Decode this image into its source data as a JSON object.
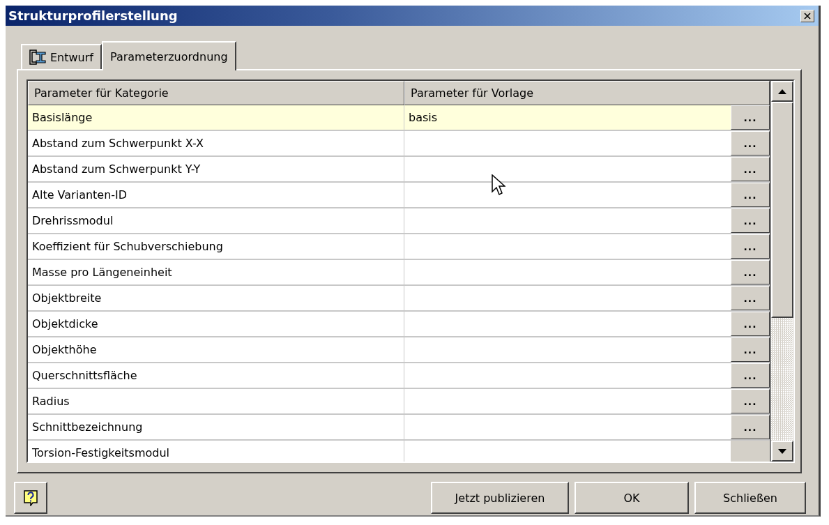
{
  "window": {
    "title": "Strukturprofilerstellung"
  },
  "tabs": [
    {
      "label": "Entwurf",
      "selected": false,
      "icon": true
    },
    {
      "label": "Parameterzuordnung",
      "selected": true,
      "icon": false
    }
  ],
  "table": {
    "columns": [
      "Parameter für Kategorie",
      "Parameter für Vorlage"
    ],
    "rows": [
      {
        "category": "Basislänge",
        "template": "basis",
        "button": "...",
        "selected": true
      },
      {
        "category": "Abstand zum Schwerpunkt X-X",
        "button": "...",
        "selected": false
      },
      {
        "category": "Abstand zum Schwerpunkt Y-Y",
        "button": "...",
        "selected": false
      },
      {
        "category": "Alte Varianten-ID",
        "button": "...",
        "selected": false
      },
      {
        "category": "Drehrissmodul",
        "button": "...",
        "selected": false
      },
      {
        "category": "Koeffizient für Schubverschiebung",
        "button": "...",
        "selected": false
      },
      {
        "category": "Masse pro Längeneinheit",
        "button": "...",
        "selected": false
      },
      {
        "category": "Objektbreite",
        "button": "...",
        "selected": false
      },
      {
        "category": "Objektdicke",
        "button": "...",
        "selected": false
      },
      {
        "category": "Objekthöhe",
        "button": "...",
        "selected": false
      },
      {
        "category": "Querschnittsfläche",
        "button": "...",
        "selected": false
      },
      {
        "category": "Radius",
        "button": "...",
        "selected": false
      },
      {
        "category": "Schnittbezeichnung",
        "button": "...",
        "selected": false
      },
      {
        "category": "Torsion-Festigkeitsmodul",
        "selected": false
      }
    ]
  },
  "buttons": [
    "Jetzt publizieren",
    "OK",
    "Schließen"
  ]
}
